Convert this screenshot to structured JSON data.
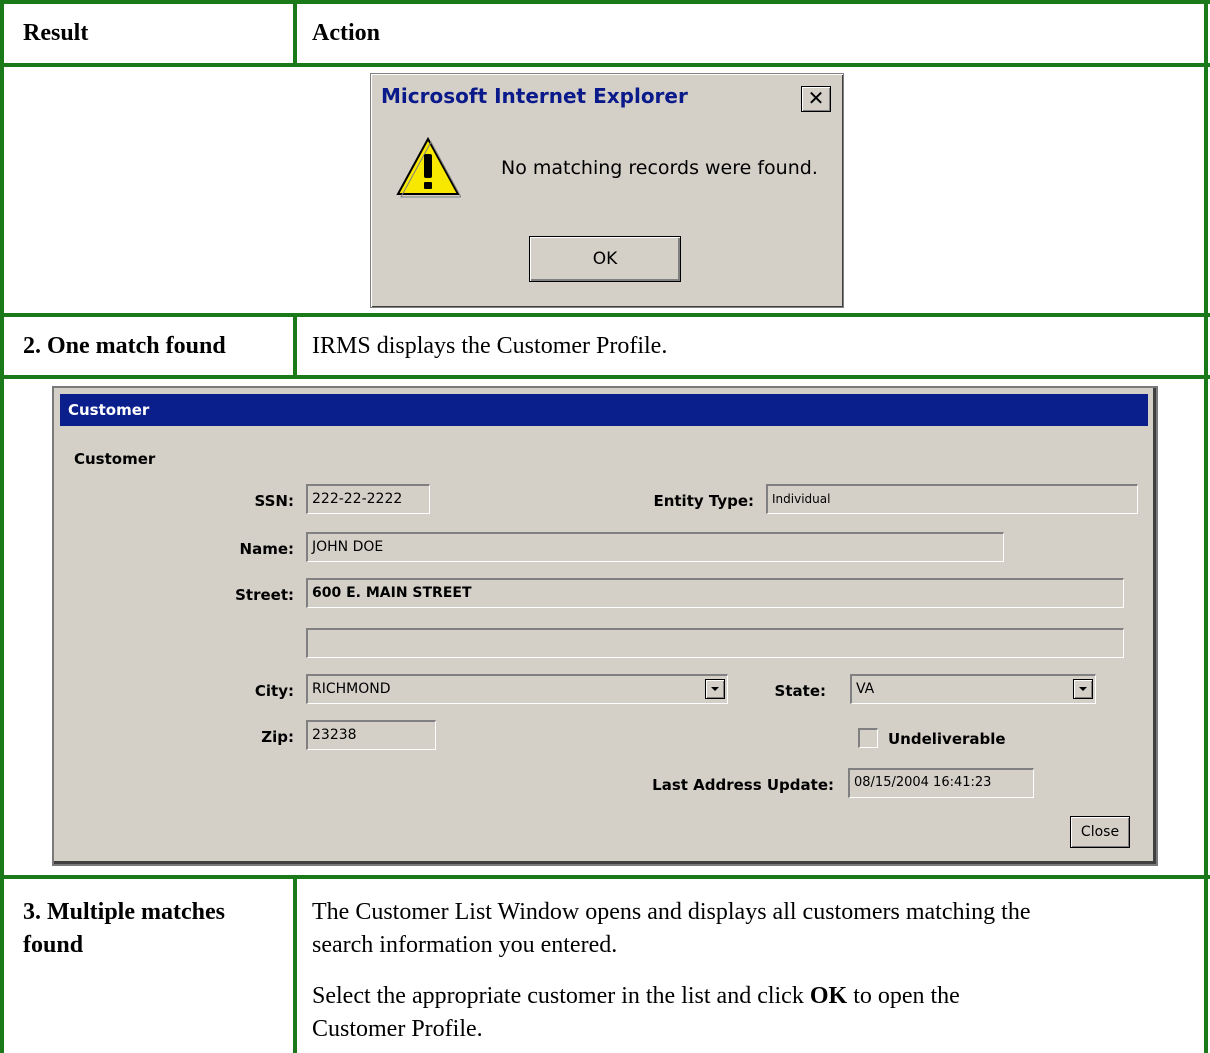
{
  "table": {
    "header": {
      "result": "Result",
      "action": "Action"
    },
    "row2": {
      "result": "2. One match found",
      "action": "IRMS displays the Customer Profile."
    },
    "row3": {
      "result_line1": "3. Multiple matches",
      "result_line2": "found",
      "action_p1_line1": "The Customer List Window opens and displays all customers matching the",
      "action_p1_line2": "search information you entered.",
      "action_p2_pre": "Select the appropriate customer in the list and click ",
      "action_p2_bold": "OK",
      "action_p2_post": " to open the",
      "action_p2_line2": "Customer Profile."
    }
  },
  "alert_dialog": {
    "title": "Microsoft Internet Explorer",
    "close_glyph": "✕",
    "icon": "warning-icon",
    "message": "No matching records were found.",
    "ok_label": "OK"
  },
  "customer_window": {
    "title": "Customer",
    "section": "Customer",
    "ssn": {
      "label": "SSN:",
      "value": "222-22-2222"
    },
    "entity_type": {
      "label": "Entity Type:",
      "value": "Individual"
    },
    "name": {
      "label": "Name:",
      "value": "JOHN DOE"
    },
    "street": {
      "label": "Street:",
      "value": "600 E. MAIN STREET",
      "value2": ""
    },
    "city": {
      "label": "City:",
      "value": "RICHMOND"
    },
    "state": {
      "label": "State:",
      "value": "VA"
    },
    "zip": {
      "label": "Zip:",
      "value": "23238"
    },
    "undeliverable": {
      "label": "Undeliverable",
      "checked": false
    },
    "last_address_update": {
      "label": "Last Address Update:",
      "value": "08/15/2004 16:41:23"
    },
    "close_label": "Close"
  },
  "colors": {
    "table_border": "#1a7a1a",
    "window_titlebar": "#0a1e8c",
    "dialog_face": "#d4d0c8",
    "alert_title": "#0b1a8a"
  }
}
